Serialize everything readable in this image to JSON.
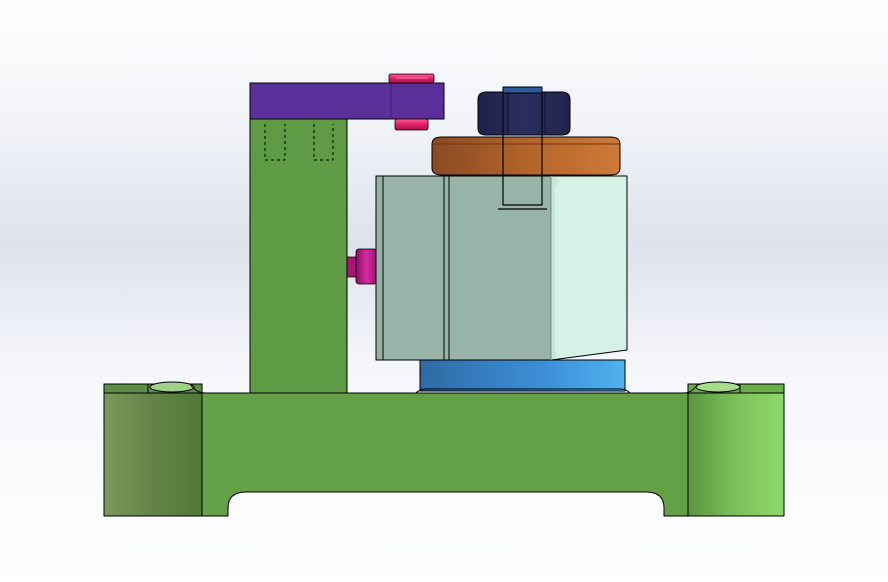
{
  "view": {
    "background": [
      "#ffffff",
      "#dde2ec"
    ],
    "outline_color": "#000000"
  },
  "parts": {
    "base_plate": {
      "color": "#64a046",
      "boss_highlight": "#8ad468"
    },
    "upright_post": {
      "color": "#5f9a45"
    },
    "top_clamp_arm": {
      "color": "#5b2f99"
    },
    "cap_screws": {
      "color": "#e0206a"
    },
    "side_screw": {
      "color": "#c21e90"
    },
    "block": {
      "color": "#98b4a8",
      "end_face": "#d4f2e6"
    },
    "bottom_spacer": {
      "color": "#3d8fd8"
    },
    "washer": {
      "color": "#b2642a"
    },
    "hex_nut": {
      "color": "#252a55"
    }
  }
}
